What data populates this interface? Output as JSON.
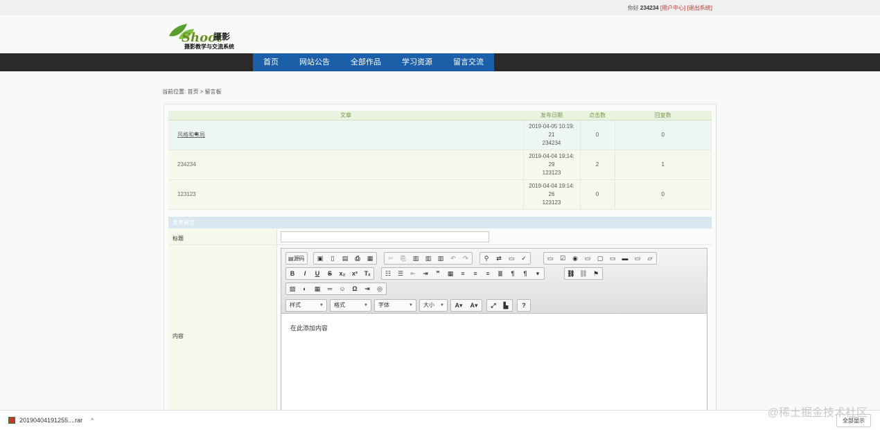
{
  "topbar": {
    "greeting": "你好",
    "username": "234234",
    "user_center": "[用户中心]",
    "logout": "[退出系统]"
  },
  "logo": {
    "word": "Shoot",
    "cn": "摄影",
    "subtitle": "摄影教学与交流系统"
  },
  "nav": {
    "items": [
      "首页",
      "网站公告",
      "全部作品",
      "学习资源",
      "留言交流"
    ]
  },
  "breadcrumb": "当前位置: 首页 > 留言板",
  "table": {
    "headers": [
      "文章",
      "发布日期",
      "点击数",
      "回复数"
    ],
    "rows": [
      {
        "title": "风格和布局",
        "date_line1": "2019-04-05 10:19:",
        "date_line2": "21",
        "author": "234234",
        "clicks": "0",
        "replies": "0"
      },
      {
        "title": "234234",
        "date_line1": "2019-04-04 19:14:",
        "date_line2": "29",
        "author": "123123",
        "clicks": "2",
        "replies": "1"
      },
      {
        "title": "123123",
        "date_line1": "2019-04-04 19:14:",
        "date_line2": "26",
        "author": "123123",
        "clicks": "0",
        "replies": "0"
      }
    ]
  },
  "form": {
    "header": "发表留言",
    "title_label": "标题",
    "content_label": "内容",
    "title_value": "",
    "editor": {
      "source_label": "源码",
      "style_select": "样式",
      "format_select": "格式",
      "font_select": "字体",
      "size_select": "大小",
      "content_placeholder": "在此添加内容"
    }
  },
  "download_bar": {
    "filename": "20190404191255....rar",
    "show_all": "全部显示"
  },
  "watermark": "@稀土掘金技术社区"
}
